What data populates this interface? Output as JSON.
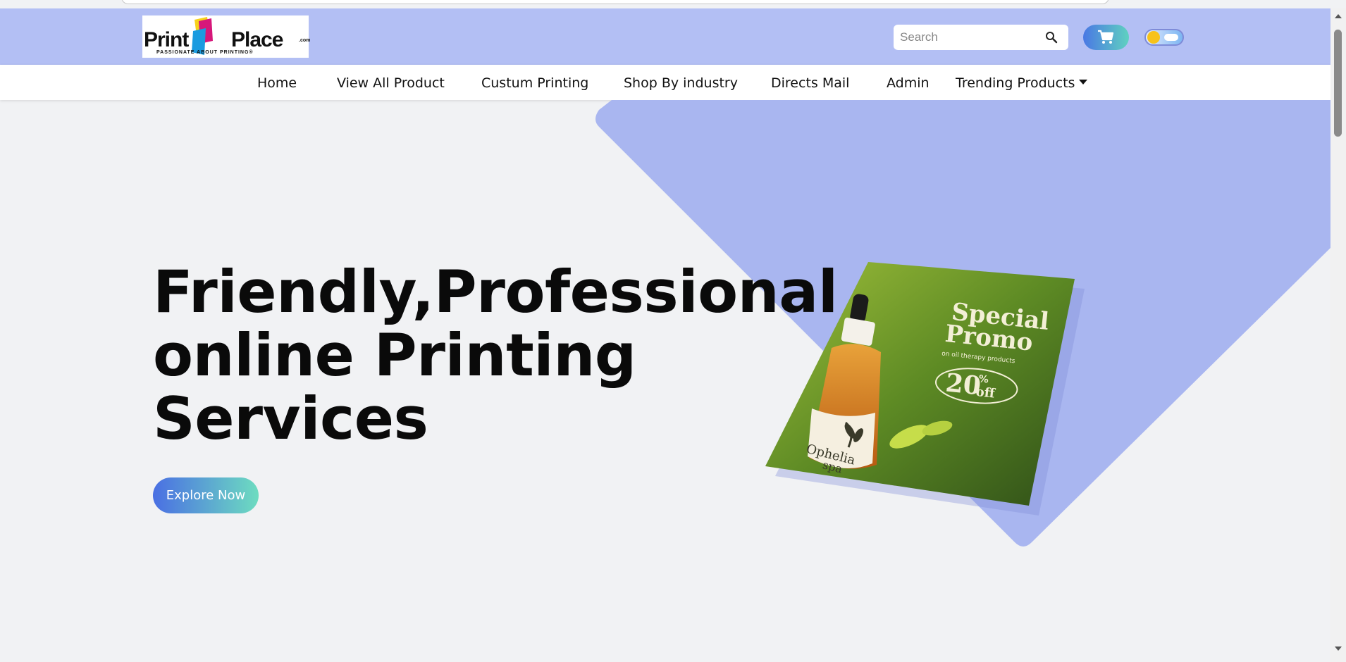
{
  "brand": {
    "logo_text_1": "Print",
    "logo_text_2": "Place",
    "logo_suffix": ".com",
    "logo_tagline": "PASSIONATE ABOUT PRINTING®"
  },
  "search": {
    "placeholder": "Search",
    "icon": "search-icon"
  },
  "cart": {
    "icon": "cart-icon"
  },
  "theme_toggle": {
    "icon": "sun-cloud-toggle",
    "state": "light"
  },
  "nav": {
    "items": [
      {
        "label": "Home"
      },
      {
        "label": "View All Product"
      },
      {
        "label": "Custum Printing"
      },
      {
        "label": "Shop By industry"
      },
      {
        "label": "Directs Mail"
      },
      {
        "label": "Admin"
      },
      {
        "label": "Trending Products",
        "dropdown": true
      }
    ]
  },
  "hero": {
    "title_line_1": "Friendly,Professional",
    "title_line_2": "online Printing",
    "title_line_3": "Services",
    "cta_label": "Explore Now"
  },
  "promo": {
    "headline_1": "Special",
    "headline_2": "Promo",
    "subline": "on oil therapy products",
    "discount_number": "20",
    "discount_percent": "%",
    "discount_off": "off",
    "brand_1": "Ophelia",
    "brand_2": "spa"
  },
  "colors": {
    "header_bg": "#b3bff4",
    "hero_shape": "#a9b6f0",
    "accent_gradient_start": "#4a6fe3",
    "accent_gradient_end": "#6ddcc0",
    "page_bg": "#f1f2f4"
  }
}
